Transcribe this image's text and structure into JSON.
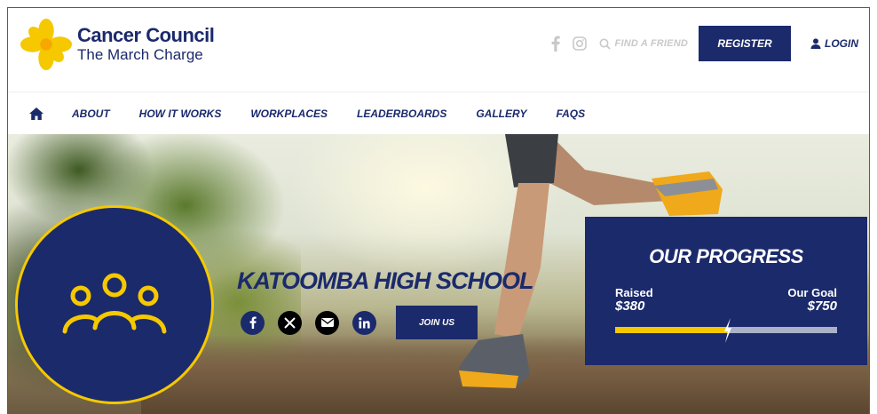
{
  "header": {
    "brand": "Cancer Council",
    "tagline": "The March Charge",
    "find_friend": "FIND A FRIEND",
    "register": "REGISTER",
    "login": "LOGIN"
  },
  "nav": {
    "items": [
      "ABOUT",
      "HOW IT WORKS",
      "WORKPLACES",
      "LEADERBOARDS",
      "GALLERY",
      "FAQS"
    ]
  },
  "hero": {
    "team_name": "KATOOMBA HIGH SCHOOL",
    "join": "JOIN US"
  },
  "progress": {
    "title": "OUR PROGRESS",
    "raised_label": "Raised",
    "raised_value": "$380",
    "goal_label": "Our Goal",
    "goal_value": "$750",
    "fraction": 0.507
  },
  "colors": {
    "navy": "#1b2a6b",
    "yellow": "#f5c800"
  }
}
